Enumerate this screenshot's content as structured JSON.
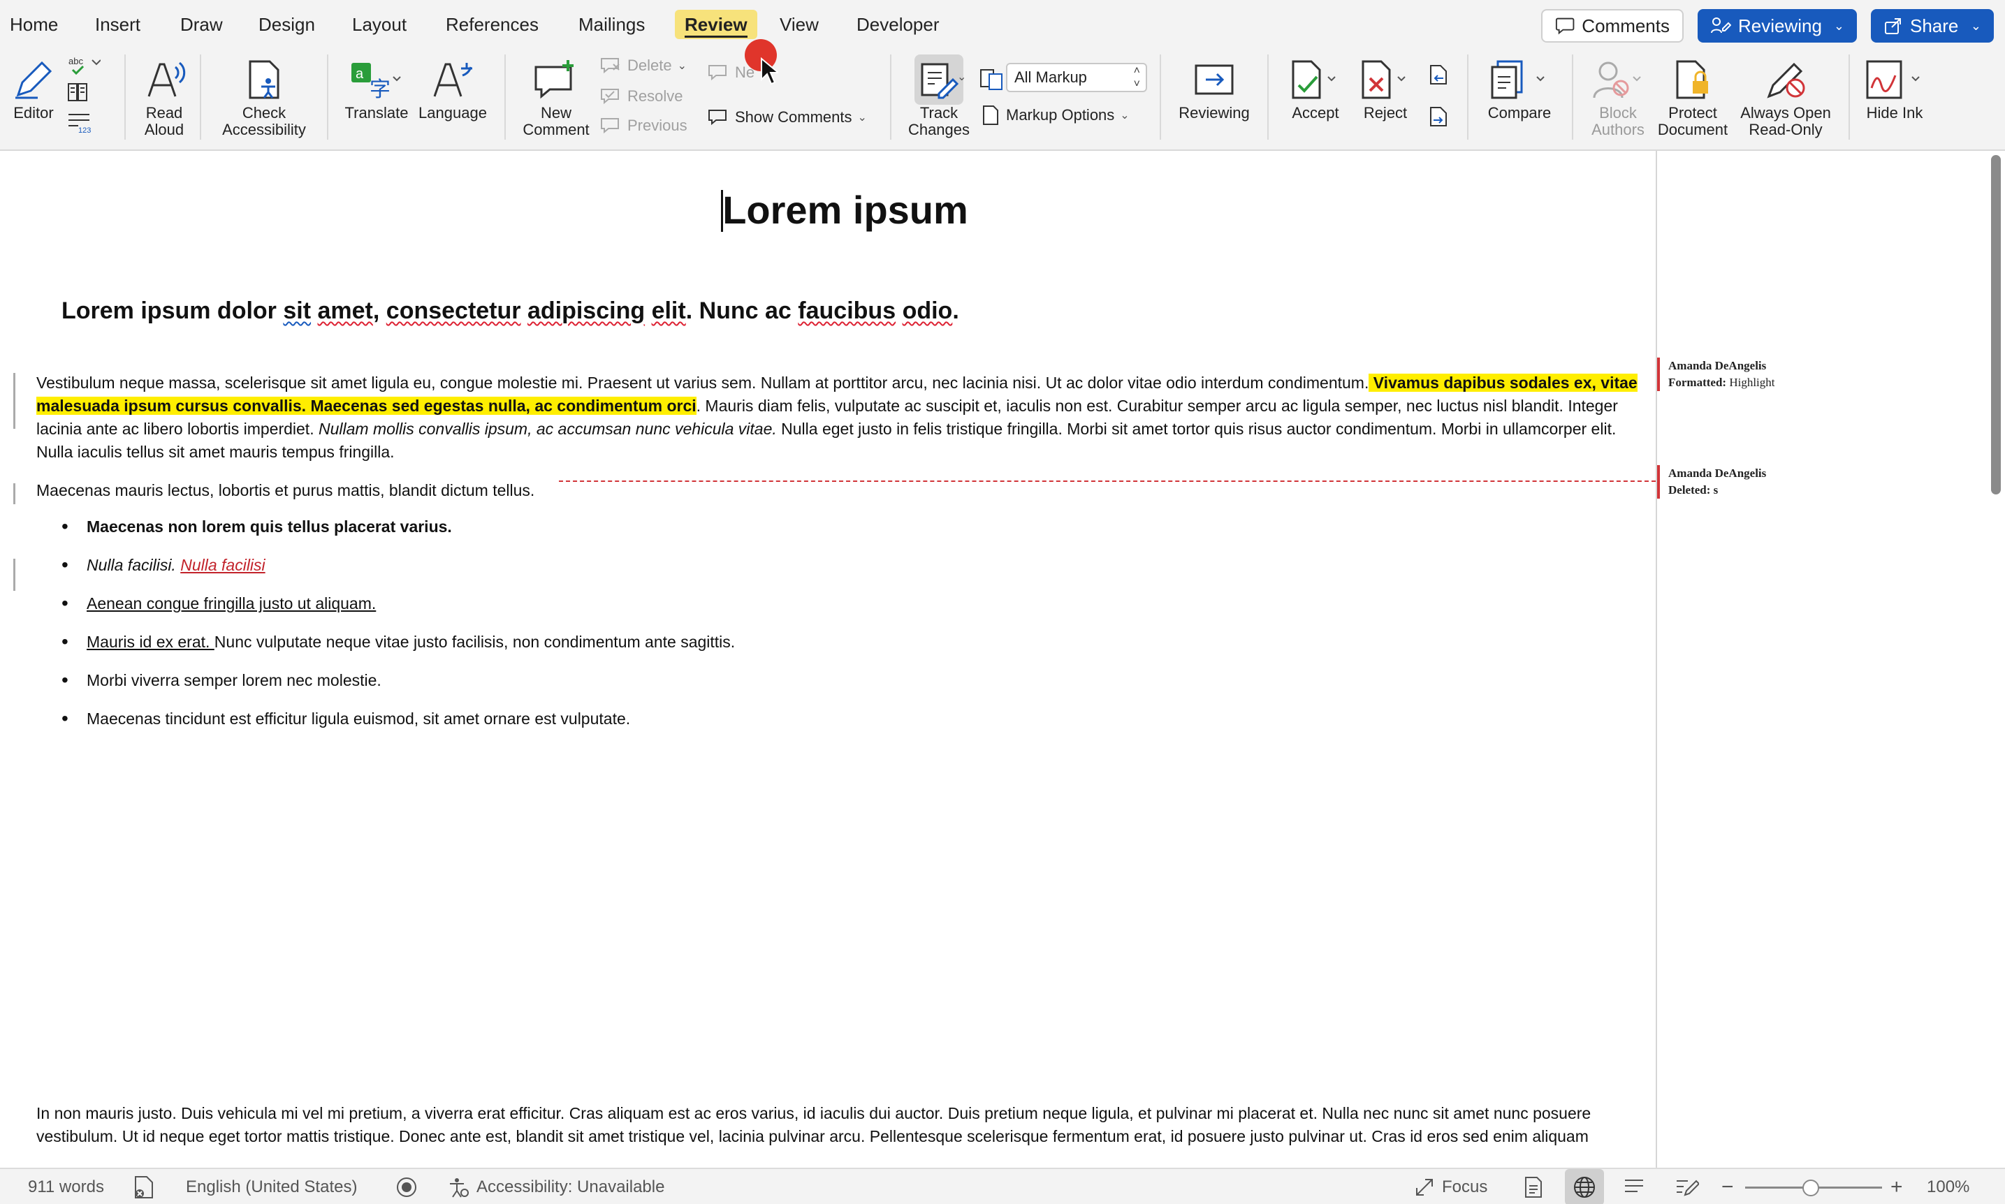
{
  "tabs": [
    "Home",
    "Insert",
    "Draw",
    "Design",
    "Layout",
    "References",
    "Mailings",
    "Review",
    "View",
    "Developer"
  ],
  "active_tab": "Review",
  "top_buttons": {
    "comments": "Comments",
    "reviewing": "Reviewing",
    "share": "Share"
  },
  "ribbon": {
    "editor": "Editor",
    "read_aloud": [
      "Read",
      "Aloud"
    ],
    "check_accessibility": [
      "Check",
      "Accessibility"
    ],
    "translate": "Translate",
    "language": "Language",
    "new_comment": [
      "New",
      "Comment"
    ],
    "delete": "Delete",
    "resolve": "Resolve",
    "previous": "Previous",
    "next": "Ne",
    "show_comments": "Show Comments",
    "track_changes": [
      "Track",
      "Changes"
    ],
    "markup_select": "All Markup",
    "markup_options": "Markup Options",
    "reviewing": "Reviewing",
    "accept": "Accept",
    "reject": "Reject",
    "compare": "Compare",
    "block_authors": [
      "Block",
      "Authors"
    ],
    "protect_document": [
      "Protect",
      "Document"
    ],
    "always_open_readonly": [
      "Always Open",
      "Read-Only"
    ],
    "hide_ink": "Hide Ink"
  },
  "document": {
    "title": "Lorem ipsum",
    "heading_parts": [
      "Lorem ipsum dolor ",
      "sit",
      " ",
      "amet",
      ", ",
      "consectetur",
      " ",
      "adipiscing",
      " ",
      "elit",
      ". Nunc ac ",
      "faucibus",
      " ",
      "odio",
      "."
    ],
    "para1": {
      "a": "Vestibulum neque massa, scelerisque sit amet ligula eu, congue molestie mi. Praesent ut varius sem. Nullam at porttitor arcu, nec lacinia nisi. Ut ac dolor vitae odio interdum condimentum.",
      "hl": " Vivamus dapibus sodales ex, vitae malesuada ipsum cursus convallis. Maecenas sed egestas nulla, ac condimentum orci",
      "b": ". Mauris diam felis, vulputate ac suscipit et, iaculis non est. Curabitur semper arcu ac ligula semper, nec luctus nisl blandit. Integer lacinia ante ac libero lobortis imperdiet. ",
      "it": "Nullam mollis convallis ipsum, ac accumsan nunc vehicula vitae.",
      "c": " Nulla eget justo in felis tristique fringilla. Morbi sit amet tortor quis risus auctor condimentum. Morbi in ullamcorper elit. Nulla iaculis tellus sit amet mauris tempus fringilla."
    },
    "para2": "Maecenas mauris lectus, lobortis et purus mattis, blandit dictum tellus.",
    "bullets": {
      "b1": "Maecenas non lorem quis tellus placerat varius.",
      "b2_plain": "Nulla facilisi.",
      "b2_ins": "Nulla facilisi",
      "b3": "Aenean congue fringilla justo ut aliquam. ",
      "b4_ul": "Mauris id ex erat. ",
      "b4_rest": "Nunc vulputate neque vitae justo facilisis, non condimentum ante sagittis.",
      "b5": "Morbi viverra semper lorem nec molestie.",
      "b6": "Maecenas tincidunt est efficitur ligula euismod, sit amet ornare est vulputate."
    },
    "para3": "In non mauris justo. Duis vehicula mi vel mi pretium, a viverra erat efficitur. Cras aliquam est ac eros varius, id iaculis dui auctor. Duis pretium neque ligula, et pulvinar mi placerat et. Nulla nec nunc sit amet nunc posuere vestibulum. Ut id neque eget tortor mattis tristique. Donec ante est, blandit sit amet tristique vel, lacinia pulvinar arcu. Pellentesque scelerisque fermentum erat, id posuere justo pulvinar ut. Cras id eros sed enim aliquam"
  },
  "balloons": [
    {
      "author": "Amanda DeAngelis",
      "kind": "Formatted:",
      "detail": "Highlight"
    },
    {
      "author": "Amanda DeAngelis",
      "kind": "Deleted:",
      "detail": "s"
    }
  ],
  "status": {
    "words": "911 words",
    "language": "English (United States)",
    "accessibility": "Accessibility: Unavailable",
    "focus": "Focus",
    "zoom": "100%"
  },
  "colors": {
    "accent": "#185abd",
    "highlight": "#ffee00",
    "review_tab": "#f7e27b",
    "revision": "#d13438"
  }
}
